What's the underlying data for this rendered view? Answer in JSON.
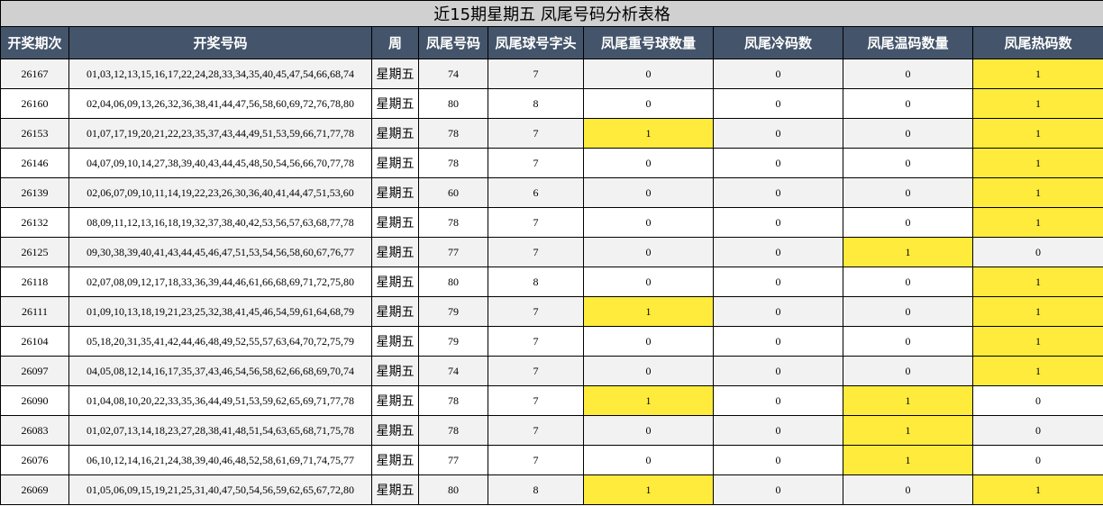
{
  "title": "近15期星期五 凤尾号码分析表格",
  "headers": [
    "开奖期次",
    "开奖号码",
    "周",
    "凤尾号码",
    "凤尾球号字头",
    "凤尾重号球数量",
    "凤尾冷码数",
    "凤尾温码数量",
    "凤尾热码数"
  ],
  "highlight_color": "#ffeb3b",
  "header_color": "#44546a",
  "rows": [
    {
      "issue": "26167",
      "numbers": "01,03,12,13,15,16,17,22,24,28,33,34,35,40,45,47,54,66,68,74",
      "week": "星期五",
      "tail": "74",
      "head": "7",
      "repeat": "0",
      "cold": "0",
      "warm": "0",
      "hot": "1",
      "hl": [
        "hot"
      ]
    },
    {
      "issue": "26160",
      "numbers": "02,04,06,09,13,26,32,36,38,41,44,47,56,58,60,69,72,76,78,80",
      "week": "星期五",
      "tail": "80",
      "head": "8",
      "repeat": "0",
      "cold": "0",
      "warm": "0",
      "hot": "1",
      "hl": [
        "hot"
      ]
    },
    {
      "issue": "26153",
      "numbers": "01,07,17,19,20,21,22,23,35,37,43,44,49,51,53,59,66,71,77,78",
      "week": "星期五",
      "tail": "78",
      "head": "7",
      "repeat": "1",
      "cold": "0",
      "warm": "0",
      "hot": "1",
      "hl": [
        "repeat",
        "hot"
      ]
    },
    {
      "issue": "26146",
      "numbers": "04,07,09,10,14,27,38,39,40,43,44,45,48,50,54,56,66,70,77,78",
      "week": "星期五",
      "tail": "78",
      "head": "7",
      "repeat": "0",
      "cold": "0",
      "warm": "0",
      "hot": "1",
      "hl": [
        "hot"
      ]
    },
    {
      "issue": "26139",
      "numbers": "02,06,07,09,10,11,14,19,22,23,26,30,36,40,41,44,47,51,53,60",
      "week": "星期五",
      "tail": "60",
      "head": "6",
      "repeat": "0",
      "cold": "0",
      "warm": "0",
      "hot": "1",
      "hl": [
        "hot"
      ]
    },
    {
      "issue": "26132",
      "numbers": "08,09,11,12,13,16,18,19,32,37,38,40,42,53,56,57,63,68,77,78",
      "week": "星期五",
      "tail": "78",
      "head": "7",
      "repeat": "0",
      "cold": "0",
      "warm": "0",
      "hot": "1",
      "hl": [
        "hot"
      ]
    },
    {
      "issue": "26125",
      "numbers": "09,30,38,39,40,41,43,44,45,46,47,51,53,54,56,58,60,67,76,77",
      "week": "星期五",
      "tail": "77",
      "head": "7",
      "repeat": "0",
      "cold": "0",
      "warm": "1",
      "hot": "0",
      "hl": [
        "warm"
      ]
    },
    {
      "issue": "26118",
      "numbers": "02,07,08,09,12,17,18,33,36,39,44,46,61,66,68,69,71,72,75,80",
      "week": "星期五",
      "tail": "80",
      "head": "8",
      "repeat": "0",
      "cold": "0",
      "warm": "0",
      "hot": "1",
      "hl": [
        "hot"
      ]
    },
    {
      "issue": "26111",
      "numbers": "01,09,10,13,18,19,21,23,25,32,38,41,45,46,54,59,61,64,68,79",
      "week": "星期五",
      "tail": "79",
      "head": "7",
      "repeat": "1",
      "cold": "0",
      "warm": "0",
      "hot": "1",
      "hl": [
        "repeat",
        "hot"
      ]
    },
    {
      "issue": "26104",
      "numbers": "05,18,20,31,35,41,42,44,46,48,49,52,55,57,63,64,70,72,75,79",
      "week": "星期五",
      "tail": "79",
      "head": "7",
      "repeat": "0",
      "cold": "0",
      "warm": "0",
      "hot": "1",
      "hl": [
        "hot"
      ]
    },
    {
      "issue": "26097",
      "numbers": "04,05,08,12,14,16,17,35,37,43,46,54,56,58,62,66,68,69,70,74",
      "week": "星期五",
      "tail": "74",
      "head": "7",
      "repeat": "0",
      "cold": "0",
      "warm": "0",
      "hot": "1",
      "hl": [
        "hot"
      ]
    },
    {
      "issue": "26090",
      "numbers": "01,04,08,10,20,22,33,35,36,44,49,51,53,59,62,65,69,71,77,78",
      "week": "星期五",
      "tail": "78",
      "head": "7",
      "repeat": "1",
      "cold": "0",
      "warm": "1",
      "hot": "0",
      "hl": [
        "repeat",
        "warm"
      ]
    },
    {
      "issue": "26083",
      "numbers": "01,02,07,13,14,18,23,27,28,38,41,48,51,54,63,65,68,71,75,78",
      "week": "星期五",
      "tail": "78",
      "head": "7",
      "repeat": "0",
      "cold": "0",
      "warm": "1",
      "hot": "0",
      "hl": [
        "warm"
      ]
    },
    {
      "issue": "26076",
      "numbers": "06,10,12,14,16,21,24,38,39,40,46,48,52,58,61,69,71,74,75,77",
      "week": "星期五",
      "tail": "77",
      "head": "7",
      "repeat": "0",
      "cold": "0",
      "warm": "1",
      "hot": "0",
      "hl": [
        "warm"
      ]
    },
    {
      "issue": "26069",
      "numbers": "01,05,06,09,15,19,21,25,31,40,47,50,54,56,59,62,65,67,72,80",
      "week": "星期五",
      "tail": "80",
      "head": "8",
      "repeat": "1",
      "cold": "0",
      "warm": "0",
      "hot": "1",
      "hl": [
        "repeat",
        "hot"
      ]
    }
  ]
}
